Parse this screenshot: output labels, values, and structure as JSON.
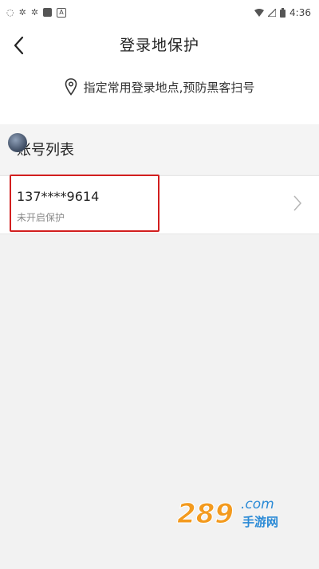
{
  "status_bar": {
    "time": "4:36"
  },
  "header": {
    "title": "登录地保护",
    "tip": "指定常用登录地点,预防黑客扫号"
  },
  "section": {
    "title": "账号列表"
  },
  "accounts": [
    {
      "number": "137****9614",
      "status": "未开启保护"
    }
  ],
  "colors": {
    "highlight": "#d21f1f",
    "watermark_orange": "#f39a1e",
    "watermark_blue": "#2a8ad6"
  },
  "watermark": {
    "brand": "289",
    "suffix": ".com",
    "subtitle": "手游网"
  }
}
